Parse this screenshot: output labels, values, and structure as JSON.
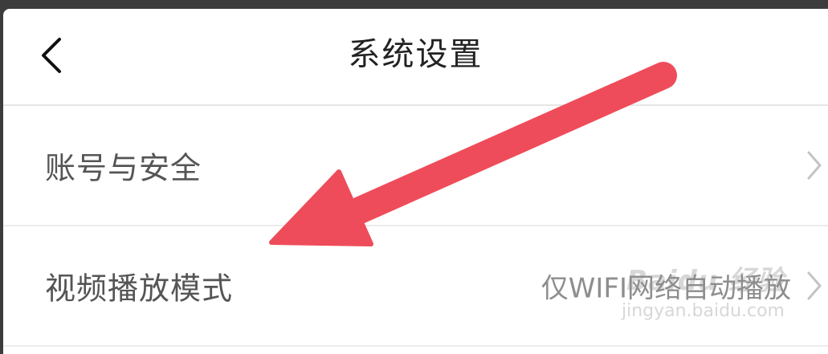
{
  "header": {
    "title": "系统设置",
    "back_icon": "chevron-left-icon"
  },
  "settings": {
    "rows": [
      {
        "label": "账号与安全",
        "value": "",
        "icon": "chevron-right-icon"
      },
      {
        "label": "视频播放模式",
        "value": "仅WIFI网络自动播放",
        "icon": "chevron-right-icon"
      }
    ]
  },
  "annotation": {
    "icon": "red-arrow-annotation",
    "color": "#ee4c5a"
  },
  "watermark": {
    "main": "Baidu 经验",
    "url": "jingyan.baidu.com"
  }
}
